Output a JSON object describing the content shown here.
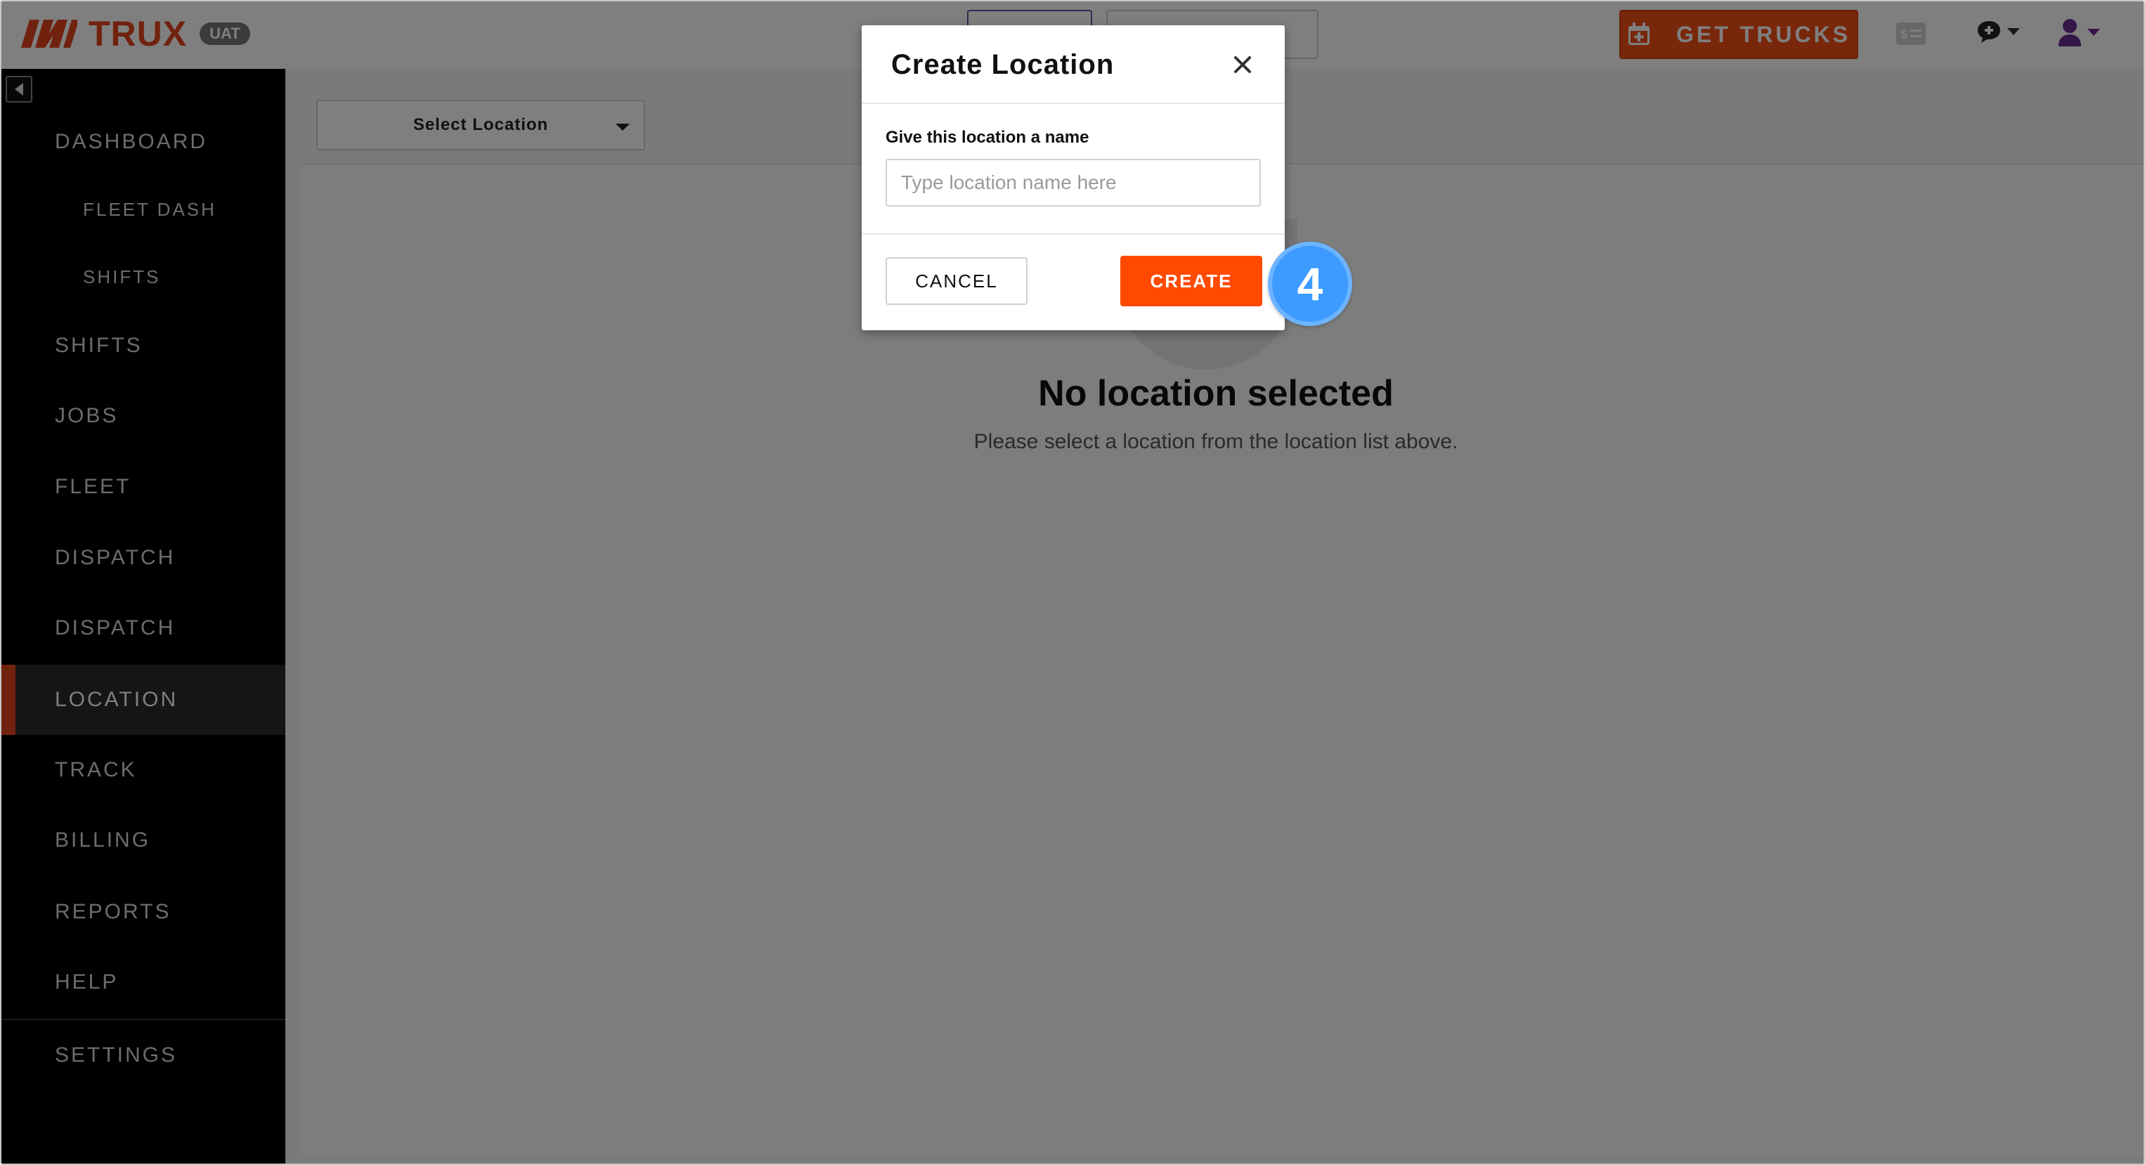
{
  "header": {
    "logo_text": "TRUX",
    "env_badge": "UAT",
    "get_trucks_label": "GET TRUCKS",
    "icons": [
      "calendar-plus-icon",
      "billing-icon",
      "chat-icon",
      "user-icon"
    ],
    "brand_color": "#e2451c"
  },
  "sidebar": {
    "items": [
      {
        "label": "DASHBOARD",
        "sub": false,
        "active": false
      },
      {
        "label": "FLEET DASH",
        "sub": true,
        "active": false
      },
      {
        "label": "SHIFTS",
        "sub": true,
        "active": false
      },
      {
        "label": "SHIFTS",
        "sub": false,
        "active": false
      },
      {
        "label": "JOBS",
        "sub": false,
        "active": false
      },
      {
        "label": "FLEET",
        "sub": false,
        "active": false
      },
      {
        "label": "DISPATCH",
        "sub": false,
        "active": false
      },
      {
        "label": "DISPATCH",
        "sub": false,
        "active": false
      },
      {
        "label": "LOCATION",
        "sub": false,
        "active": true
      },
      {
        "label": "TRACK",
        "sub": false,
        "active": false
      },
      {
        "label": "BILLING",
        "sub": false,
        "active": false
      },
      {
        "label": "REPORTS",
        "sub": false,
        "active": false
      },
      {
        "label": "HELP",
        "sub": false,
        "active": false
      },
      {
        "label": "SETTINGS",
        "sub": false,
        "active": false
      }
    ]
  },
  "main": {
    "location_select_label": "Select Location",
    "empty_title": "No location selected",
    "empty_subtitle": "Please select a location from the location list above."
  },
  "modal": {
    "title": "Create Location",
    "field_label": "Give this location a name",
    "field_placeholder": "Type location name here",
    "field_value": "",
    "cancel_label": "CANCEL",
    "create_label": "CREATE",
    "create_color": "#ff4a00"
  },
  "step_badge": "4"
}
